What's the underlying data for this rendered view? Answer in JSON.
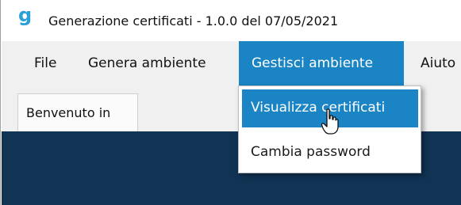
{
  "window": {
    "app_icon": "g",
    "title": "Generazione certificati - 1.0.0 del 07/05/2021"
  },
  "menubar": {
    "items": [
      {
        "label": "File"
      },
      {
        "label": "Genera ambiente"
      },
      {
        "label": "Gestisci ambiente"
      },
      {
        "label": "Aiuto"
      }
    ]
  },
  "tabs": [
    {
      "label": "Benvenuto in"
    }
  ],
  "dropdown": {
    "items": [
      {
        "label": "Visualizza certificati"
      },
      {
        "label": "Cambia password"
      }
    ]
  },
  "colors": {
    "accent": "#1a84c4",
    "content_background": "#113354",
    "icon": "#2a9fd8"
  }
}
